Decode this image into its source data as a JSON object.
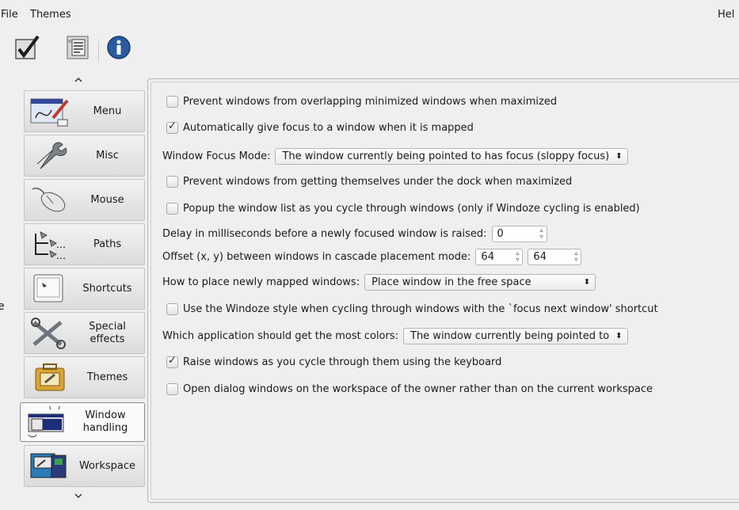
{
  "menubar": {
    "file": "File",
    "themes": "Themes",
    "help": "Hel"
  },
  "toolbar": {
    "items": [
      "checkmark-icon",
      "document-icon",
      "info-icon"
    ]
  },
  "stray_char": "e",
  "sidebar": {
    "items": [
      {
        "label": "Menu",
        "icon": "menu-editor-icon"
      },
      {
        "label": "Misc",
        "icon": "wrench-icon"
      },
      {
        "label": "Mouse",
        "icon": "mouse-icon"
      },
      {
        "label": "Paths",
        "icon": "paths-icon"
      },
      {
        "label": "Shortcuts",
        "icon": "keyboard-key-icon"
      },
      {
        "label": "Special effects",
        "icon": "tools-icon"
      },
      {
        "label": "Themes",
        "icon": "themes-case-icon"
      },
      {
        "label": "Window handling",
        "icon": "window-handling-icon"
      },
      {
        "label": "Workspace",
        "icon": "workspace-icon"
      }
    ],
    "active": "Window handling"
  },
  "options": {
    "prevent_overlap_minimized": {
      "label": "Prevent windows from overlapping minimized windows when maximized",
      "checked": false
    },
    "auto_focus_mapped": {
      "label": "Automatically give focus to a window when it is mapped",
      "checked": true
    },
    "focus_mode": {
      "label": "Window Focus Mode:",
      "value": "The window currently being pointed to has focus (sloppy focus)"
    },
    "prevent_under_dock": {
      "label": "Prevent windows from getting themselves under the dock when maximized",
      "checked": false
    },
    "popup_window_list": {
      "label": "Popup the window list as you cycle through windows (only if Windoze cycling is enabled)",
      "checked": false
    },
    "raise_delay": {
      "label": "Delay in milliseconds before a newly focused window is raised:",
      "value": "0"
    },
    "cascade_offset": {
      "label": "Offset (x, y) between windows in cascade placement mode:",
      "x": "64",
      "y": "64"
    },
    "placement": {
      "label": "How to place newly mapped windows:",
      "value": "Place window in the free space"
    },
    "windoze_style": {
      "label": "Use the Windoze style when cycling through windows with the `focus next window' shortcut",
      "checked": false
    },
    "most_colors": {
      "label": "Which application should get the most colors:",
      "value": "The window currently being pointed to"
    },
    "raise_cycling": {
      "label": "Raise windows as you cycle through them using the keyboard",
      "checked": true
    },
    "dialog_owner_workspace": {
      "label": "Open dialog windows on the workspace of the owner rather than on the current workspace",
      "checked": false
    }
  },
  "glyphs": {
    "check": "✓",
    "updown": "⬍",
    "up": "⌃",
    "down": "⌄"
  }
}
